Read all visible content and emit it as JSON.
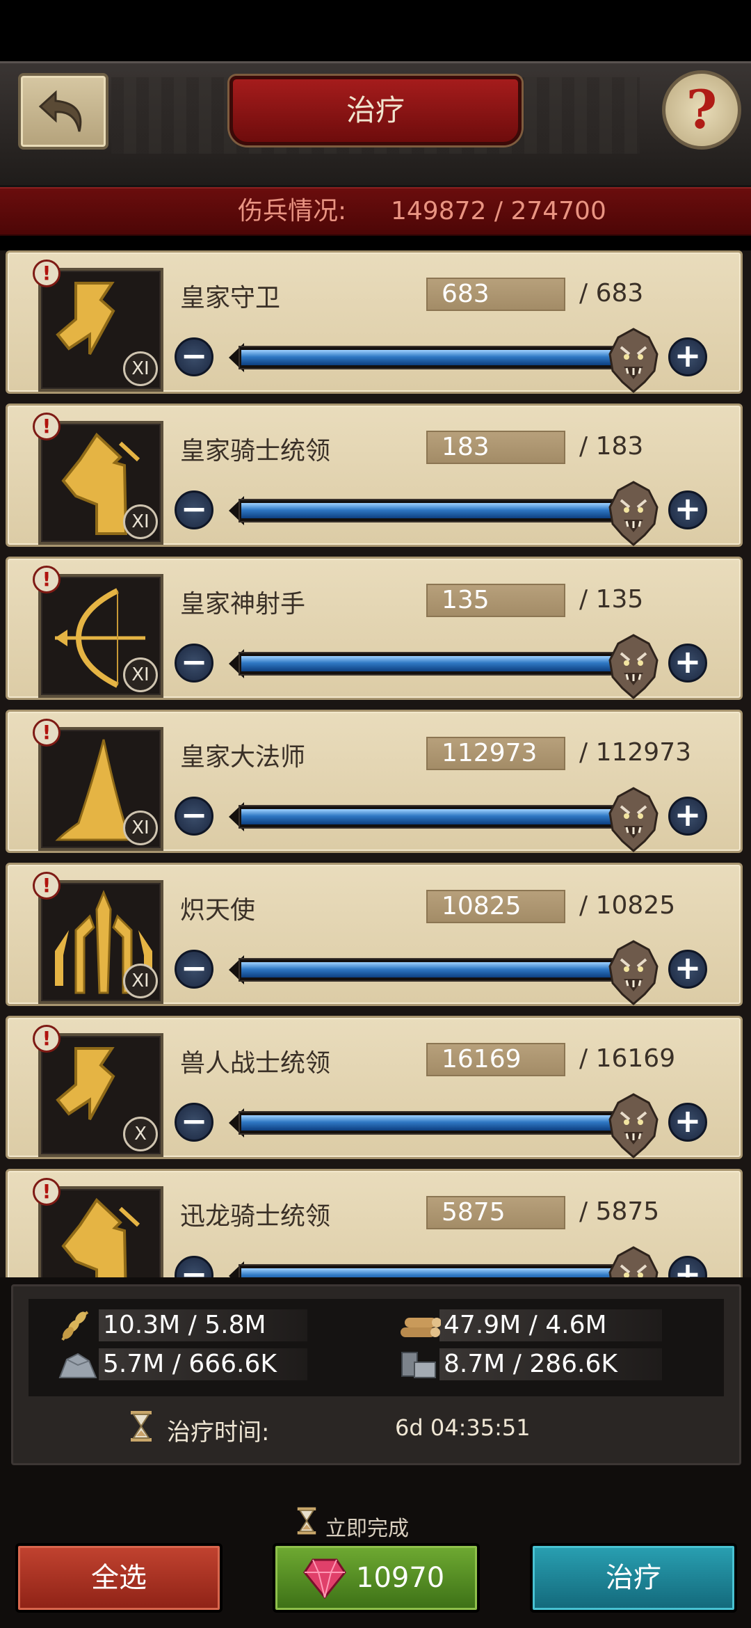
{
  "header": {
    "title": "治疗",
    "wounded_label": "伤兵情况:",
    "wounded_value": "149872 / 274700"
  },
  "troops": [
    {
      "name": "皇家守卫",
      "count": "683",
      "max": "/ 683",
      "tier": "XI",
      "icon": "shield-icon",
      "fill": 1.0
    },
    {
      "name": "皇家骑士统领",
      "count": "183",
      "max": "/ 183",
      "tier": "XI",
      "icon": "horse-icon",
      "fill": 1.0
    },
    {
      "name": "皇家神射手",
      "count": "135",
      "max": "/ 135",
      "tier": "XI",
      "icon": "bow-icon",
      "fill": 1.0
    },
    {
      "name": "皇家大法师",
      "count": "112973",
      "max": "/ 112973",
      "tier": "XI",
      "icon": "wizard-hat-icon",
      "fill": 1.0
    },
    {
      "name": "炽天使",
      "count": "10825",
      "max": "/ 10825",
      "tier": "XI",
      "icon": "seraph-icon",
      "fill": 1.0
    },
    {
      "name": "兽人战士统领",
      "count": "16169",
      "max": "/ 16169",
      "tier": "X",
      "icon": "shield-icon",
      "fill": 1.0
    },
    {
      "name": "迅龙骑士统领",
      "count": "5875",
      "max": "/ 5875",
      "tier": "",
      "icon": "horse-icon",
      "fill": 1.0
    }
  ],
  "resources": {
    "food": "10.3M / 5.8M",
    "wood": "47.9M / 4.6M",
    "stone": "5.7M / 666.6K",
    "iron": "8.7M / 286.6K"
  },
  "heal_time_label": "治疗时间:",
  "heal_time_value": "6d 04:35:51",
  "instant_label": "立即完成",
  "buttons": {
    "select_all": "全选",
    "gem_cost": "10970",
    "heal": "治疗"
  }
}
